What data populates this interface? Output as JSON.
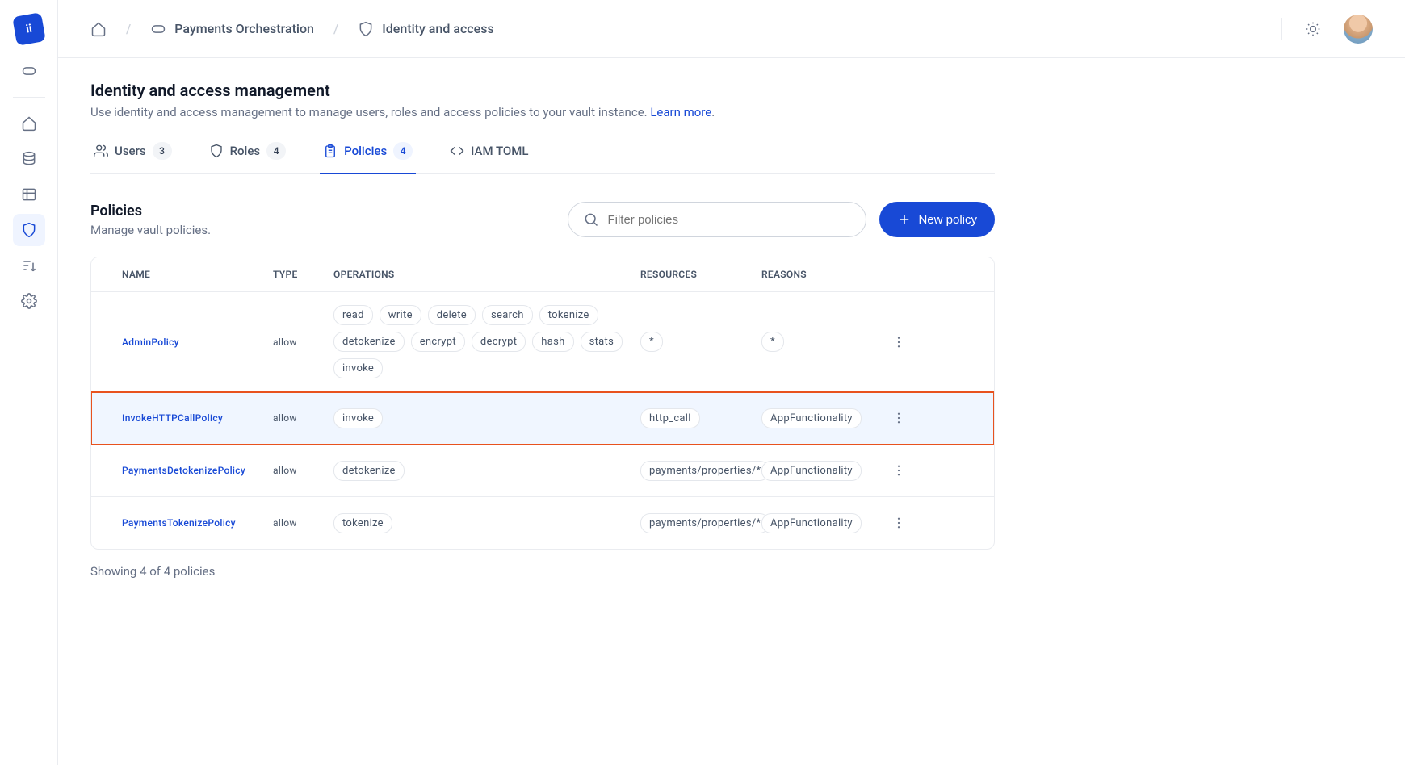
{
  "breadcrumb": {
    "item1": "Payments Orchestration",
    "item2": "Identity and access"
  },
  "page": {
    "title": "Identity and access management",
    "subtitle_pre": "Use identity and access management to manage users, roles and access policies to your vault instance. ",
    "learn_more": "Learn more",
    "subtitle_post": "."
  },
  "tabs": {
    "users": {
      "label": "Users",
      "count": "3"
    },
    "roles": {
      "label": "Roles",
      "count": "4"
    },
    "policies": {
      "label": "Policies",
      "count": "4"
    },
    "iam": {
      "label": "IAM TOML"
    }
  },
  "section": {
    "title": "Policies",
    "subtitle": "Manage vault policies."
  },
  "search": {
    "placeholder": "Filter policies"
  },
  "new_button": "New policy",
  "table": {
    "headers": {
      "name": "NAME",
      "type": "TYPE",
      "ops": "OPERATIONS",
      "res": "RESOURCES",
      "reasons": "REASONS"
    },
    "rows": [
      {
        "name": "AdminPolicy",
        "type": "allow",
        "ops": [
          "read",
          "write",
          "delete",
          "search",
          "tokenize",
          "detokenize",
          "encrypt",
          "decrypt",
          "hash",
          "stats",
          "invoke"
        ],
        "res": [
          "*"
        ],
        "reasons": [
          "*"
        ],
        "highlight": false
      },
      {
        "name": "InvokeHTTPCallPolicy",
        "type": "allow",
        "ops": [
          "invoke"
        ],
        "res": [
          "http_call"
        ],
        "reasons": [
          "AppFunctionality"
        ],
        "highlight": true
      },
      {
        "name": "PaymentsDetokenizePolicy",
        "type": "allow",
        "ops": [
          "detokenize"
        ],
        "res": [
          "payments/properties/*"
        ],
        "reasons": [
          "AppFunctionality"
        ],
        "highlight": false
      },
      {
        "name": "PaymentsTokenizePolicy",
        "type": "allow",
        "ops": [
          "tokenize"
        ],
        "res": [
          "payments/properties/*"
        ],
        "reasons": [
          "AppFunctionality"
        ],
        "highlight": false
      }
    ],
    "footer": "Showing 4 of 4 policies"
  }
}
